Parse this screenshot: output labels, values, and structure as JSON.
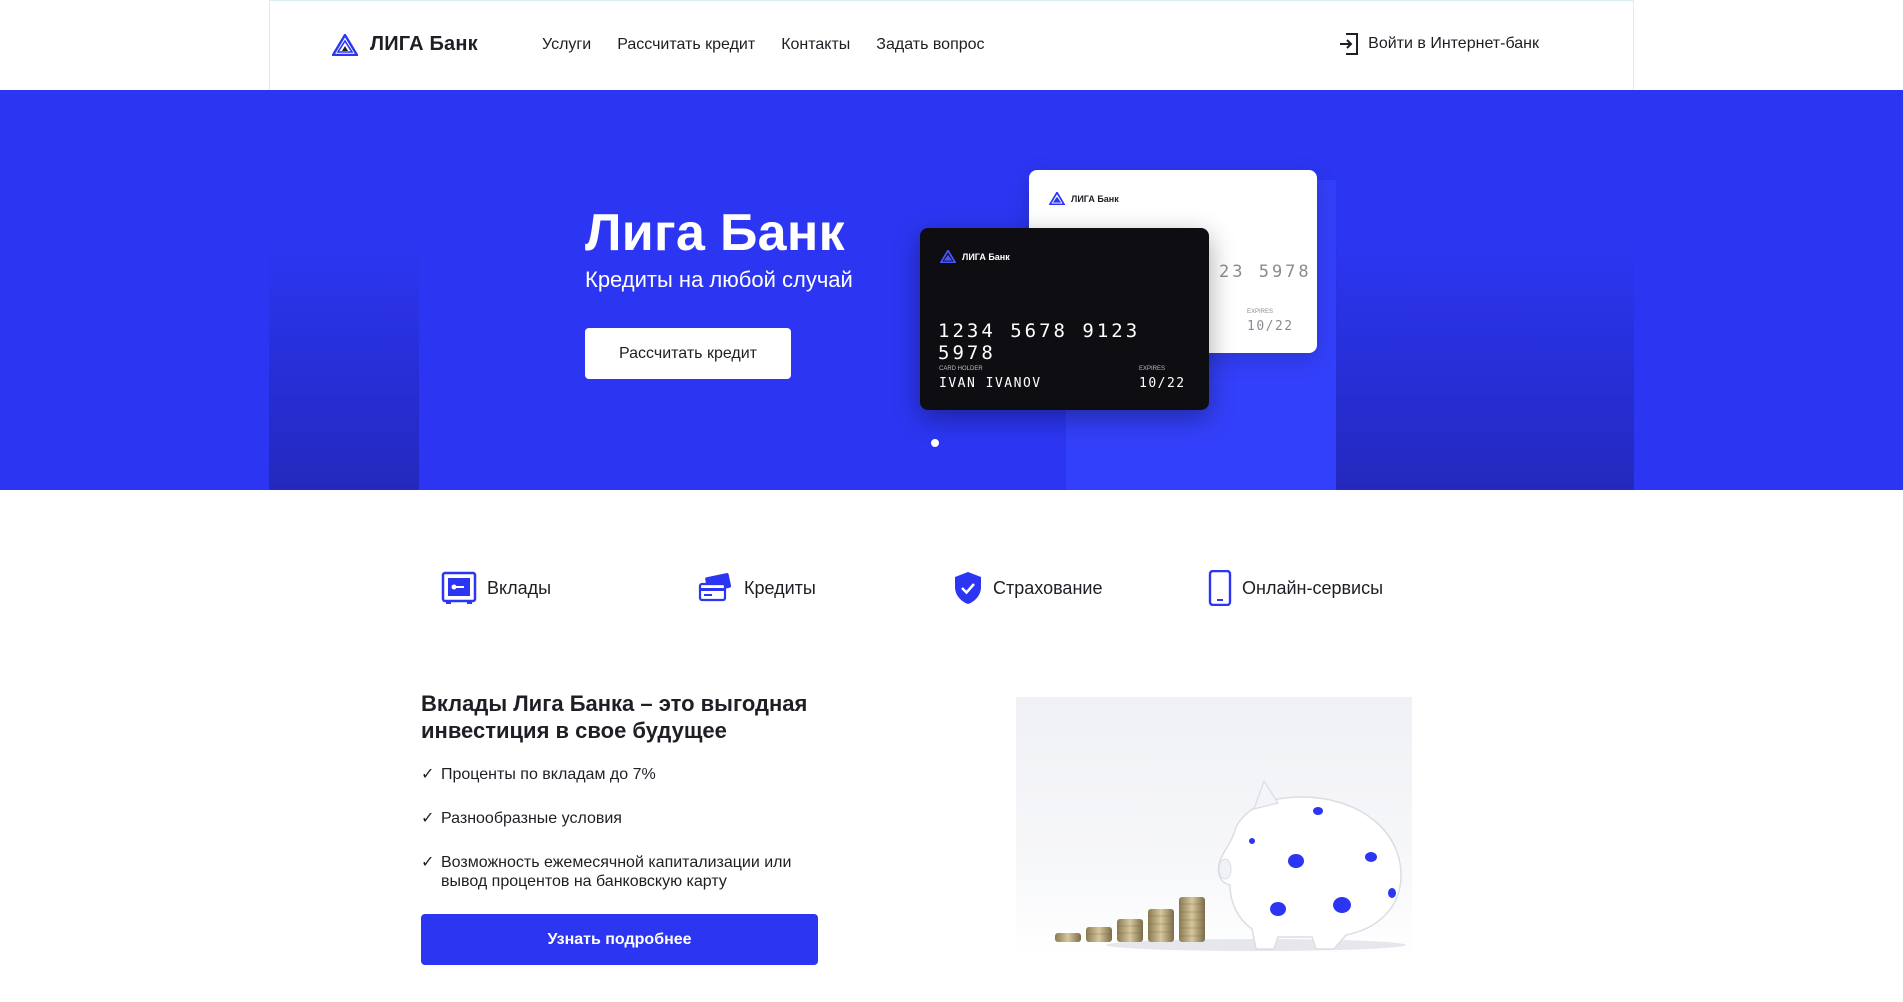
{
  "header": {
    "logo_text": "ЛИГА Банк",
    "nav": [
      "Услуги",
      "Рассчитать кредит",
      "Контакты",
      "Задать вопрос"
    ],
    "login_label": "Войти в Интернет-банк"
  },
  "hero": {
    "title": "Лига Банк",
    "subtitle": "Кредиты на любой случай",
    "button_label": "Рассчитать кредит",
    "card_front": {
      "bank_name": "ЛИГА Банк",
      "number": "1234 5678 9123 5978",
      "holder_label": "CARD HOLDER",
      "holder": "IVAN IVANOV",
      "expires_label": "EXPIRES",
      "expires": "10/22"
    },
    "card_back": {
      "bank_name": "ЛИГА Банк",
      "number_tail": "23 5978",
      "expires_label": "EXPIRES",
      "expires": "10/22"
    }
  },
  "tabs": [
    {
      "label": "Вклады",
      "icon": "safe-icon"
    },
    {
      "label": "Кредиты",
      "icon": "cards-icon"
    },
    {
      "label": "Страхование",
      "icon": "shield-icon"
    },
    {
      "label": "Онлайн-сервисы",
      "icon": "phone-icon"
    }
  ],
  "deposits": {
    "title": "Вклады Лига Банка – это выгодная инвестиция в свое будущее",
    "features": [
      "Проценты по вкладам до 7%",
      "Разнообразные условия",
      "Возможность ежемесячной капитализации или вывод процентов на банковскую карту"
    ],
    "button_label": "Узнать подробнее"
  },
  "colors": {
    "accent": "#2c36f2",
    "text": "#1f1e25"
  }
}
